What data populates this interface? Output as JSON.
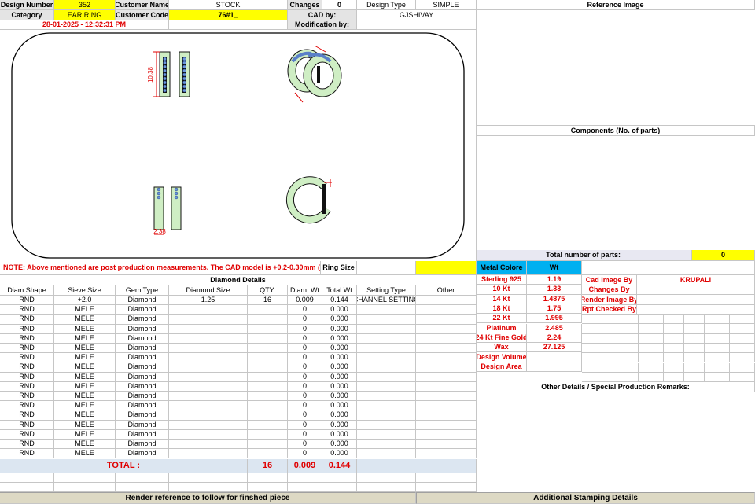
{
  "header": {
    "design_number_label": "Design Number",
    "design_number": "352",
    "customer_name_label": "Customer Name",
    "customer_name": "STOCK",
    "changes_label": "Changes",
    "changes": "0",
    "design_type_label": "Design Type",
    "design_type": "SIMPLE",
    "reference_image_label": "Reference Image",
    "category_label": "Category",
    "category": "EAR RING",
    "customer_code_label": "Customer Code",
    "customer_code": "76#1_",
    "cad_by_label": "CAD by:",
    "cad_by": "GJSHIVAY",
    "timestamp": "28-01-2025 - 12:32:31 PM",
    "modification_by_label": "Modification by:",
    "modification_by": ""
  },
  "drawing": {
    "dim_height": "10.38",
    "dim_width": "2.38"
  },
  "right_panel": {
    "components_label": "Components (No. of parts)",
    "total_parts_label": "Total number of parts:",
    "total_parts": "0"
  },
  "note": {
    "text": "NOTE: Above mentioned are post production measurements. The CAD model is +0.2-0.30mm (loss)",
    "ring_size_label": "Ring Size",
    "ring_size": ""
  },
  "diamond": {
    "title": "Diamond Details",
    "headers": [
      "Diam Shape",
      "Sieve Size",
      "Gem Type",
      "Diamond Size",
      "QTY.",
      "Diam. Wt",
      "Total Wt",
      "Setting Type",
      "Other"
    ],
    "rows": [
      [
        "RND",
        "+2.0",
        "Diamond",
        "1.25",
        "16",
        "0.009",
        "0.144",
        "CHANNEL SETTING",
        ""
      ],
      [
        "RND",
        "MELE",
        "Diamond",
        "",
        "",
        "0",
        "0.000",
        "",
        ""
      ],
      [
        "RND",
        "MELE",
        "Diamond",
        "",
        "",
        "0",
        "0.000",
        "",
        ""
      ],
      [
        "RND",
        "MELE",
        "Diamond",
        "",
        "",
        "0",
        "0.000",
        "",
        ""
      ],
      [
        "RND",
        "MELE",
        "Diamond",
        "",
        "",
        "0",
        "0.000",
        "",
        ""
      ],
      [
        "RND",
        "MELE",
        "Diamond",
        "",
        "",
        "0",
        "0.000",
        "",
        ""
      ],
      [
        "RND",
        "MELE",
        "Diamond",
        "",
        "",
        "0",
        "0.000",
        "",
        ""
      ],
      [
        "RND",
        "MELE",
        "Diamond",
        "",
        "",
        "0",
        "0.000",
        "",
        ""
      ],
      [
        "RND",
        "MELE",
        "Diamond",
        "",
        "",
        "0",
        "0.000",
        "",
        ""
      ],
      [
        "RND",
        "MELE",
        "Diamond",
        "",
        "",
        "0",
        "0.000",
        "",
        ""
      ],
      [
        "RND",
        "MELE",
        "Diamond",
        "",
        "",
        "0",
        "0.000",
        "",
        ""
      ],
      [
        "RND",
        "MELE",
        "Diamond",
        "",
        "",
        "0",
        "0.000",
        "",
        ""
      ],
      [
        "RND",
        "MELE",
        "Diamond",
        "",
        "",
        "0",
        "0.000",
        "",
        ""
      ],
      [
        "RND",
        "MELE",
        "Diamond",
        "",
        "",
        "0",
        "0.000",
        "",
        ""
      ],
      [
        "RND",
        "MELE",
        "Diamond",
        "",
        "",
        "0",
        "0.000",
        "",
        ""
      ],
      [
        "RND",
        "MELE",
        "Diamond",
        "",
        "",
        "0",
        "0.000",
        "",
        ""
      ],
      [
        "RND",
        "MELE",
        "Diamond",
        "",
        "",
        "0",
        "0.000",
        "",
        ""
      ]
    ],
    "total_label": "TOTAL :",
    "total_qty": "16",
    "total_diam_wt": "0.009",
    "total_wt": "0.144"
  },
  "metal": {
    "color_label": "Metal Colore",
    "wt_label": "Wt",
    "rows": [
      {
        "name": "Sterling 925",
        "wt": "1.19"
      },
      {
        "name": "10 Kt",
        "wt": "1.33"
      },
      {
        "name": "14 Kt",
        "wt": "1.4875"
      },
      {
        "name": "18 Kt",
        "wt": "1.75"
      },
      {
        "name": "22 Kt",
        "wt": "1.995"
      },
      {
        "name": "Platinum",
        "wt": "2.485"
      },
      {
        "name": "24 Kt Fine Gold",
        "wt": "2.24"
      },
      {
        "name": "Wax",
        "wt": "27.125"
      },
      {
        "name": "Design Volume",
        "wt": ""
      },
      {
        "name": "Design Area",
        "wt": ""
      }
    ]
  },
  "credits": {
    "cad_image_by_label": "Cad Image By",
    "cad_image_by": "KRUPALI",
    "changes_by_label": "Changes By",
    "render_image_by_label": "Render Image By",
    "rpt_checked_by_label": "Rpt Checked By"
  },
  "remarks": {
    "other_details_label": "Other Details / Special Production Remarks:"
  },
  "footer": {
    "render_reference": "Render reference to follow for finshed piece",
    "stamping": "Additional Stamping Details"
  },
  "colors": {
    "header_yellow": "#ffff00",
    "metal_blue": "#00b0f0",
    "text_red": "#e00000",
    "footer_tan": "#ddd9c4",
    "total_blue": "#dce6f1",
    "ring_green": "#cfeec4",
    "stone_blue": "#5a7fc8"
  }
}
